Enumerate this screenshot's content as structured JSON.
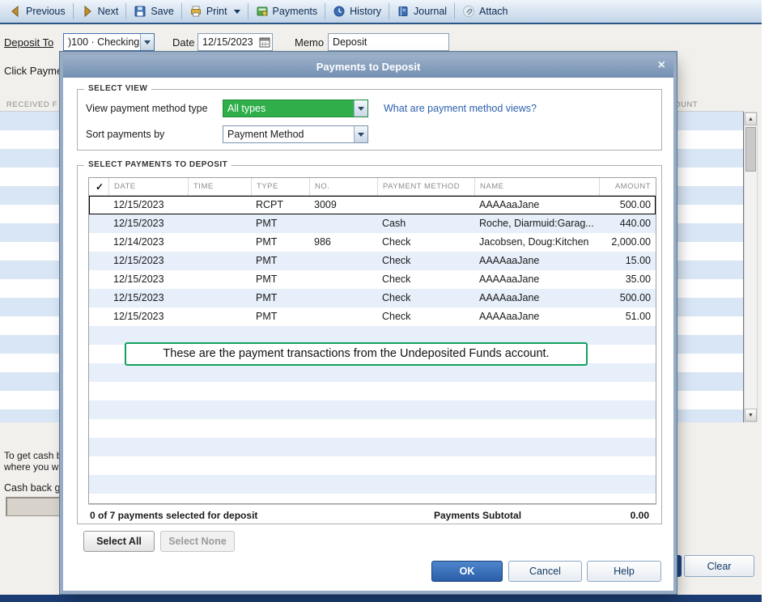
{
  "colors": {
    "dropdown_green": "#2fae4a",
    "callout_green": "#12a15e",
    "ok_blue": "#2f66b0",
    "link_blue": "#2b5fad",
    "title_bar_blue": "#7e99b8"
  },
  "toolbar": {
    "items": [
      {
        "label": "Previous",
        "icon": "previous-arrow-icon"
      },
      {
        "label": "Next",
        "icon": "next-arrow-icon"
      },
      {
        "label": "Save",
        "icon": "save-disk-icon"
      },
      {
        "label": "Print",
        "icon": "printer-icon"
      },
      {
        "label": "Payments",
        "icon": "payments-icon"
      },
      {
        "label": "History",
        "icon": "history-clock-icon"
      },
      {
        "label": "Journal",
        "icon": "journal-book-icon"
      },
      {
        "label": "Attach",
        "icon": "attach-paperclip-icon"
      }
    ]
  },
  "form": {
    "deposit_to_label": "Deposit To",
    "deposit_to_value": ")100 · Checking",
    "date_label": "Date",
    "date_value": "12/15/2023",
    "memo_label": "Memo",
    "memo_value": "Deposit",
    "click_payments_text": "Click Paymen"
  },
  "background_window": {
    "list_header_left": "RECEIVED F",
    "list_header_right": "OUNT",
    "cash_line1": "To get cash b",
    "cash_line2": "where you wa",
    "cash_back_label": "Cash back g",
    "clear_button": "Clear"
  },
  "dialog": {
    "title": "Payments to Deposit",
    "close_icon": "×",
    "select_view": {
      "section_label": "SELECT VIEW",
      "view_method_label": "View payment method type",
      "view_method_value": "All types",
      "help_link": "What are payment method views?",
      "sort_label": "Sort payments by",
      "sort_value": "Payment Method"
    },
    "payments": {
      "section_label": "SELECT PAYMENTS TO DEPOSIT",
      "check_header": "✓",
      "columns": [
        "DATE",
        "TIME",
        "TYPE",
        "NO.",
        "PAYMENT METHOD",
        "NAME",
        "AMOUNT"
      ],
      "rows": [
        {
          "date": "12/15/2023",
          "time": "",
          "type": "RCPT",
          "no": "3009",
          "method": "",
          "name": "AAAAaaJane",
          "amount": "500.00"
        },
        {
          "date": "12/15/2023",
          "time": "",
          "type": "PMT",
          "no": "",
          "method": "Cash",
          "name": "Roche, Diarmuid:Garag...",
          "amount": "440.00"
        },
        {
          "date": "12/14/2023",
          "time": "",
          "type": "PMT",
          "no": "986",
          "method": "Check",
          "name": "Jacobsen, Doug:Kitchen",
          "amount": "2,000.00"
        },
        {
          "date": "12/15/2023",
          "time": "",
          "type": "PMT",
          "no": "",
          "method": "Check",
          "name": "AAAAaaJane",
          "amount": "15.00"
        },
        {
          "date": "12/15/2023",
          "time": "",
          "type": "PMT",
          "no": "",
          "method": "Check",
          "name": "AAAAaaJane",
          "amount": "35.00"
        },
        {
          "date": "12/15/2023",
          "time": "",
          "type": "PMT",
          "no": "",
          "method": "Check",
          "name": "AAAAaaJane",
          "amount": "500.00"
        },
        {
          "date": "12/15/2023",
          "time": "",
          "type": "PMT",
          "no": "",
          "method": "Check",
          "name": "AAAAaaJane",
          "amount": "51.00"
        }
      ],
      "callout_text": "These are the payment transactions from the Undeposited Funds account.",
      "summary_left": "0 of 7 payments selected for deposit",
      "subtotal_label": "Payments Subtotal",
      "subtotal_value": "0.00",
      "select_all_label": "Select All",
      "select_none_label": "Select None"
    },
    "footer_buttons": {
      "ok": "OK",
      "cancel": "Cancel",
      "help": "Help"
    }
  }
}
